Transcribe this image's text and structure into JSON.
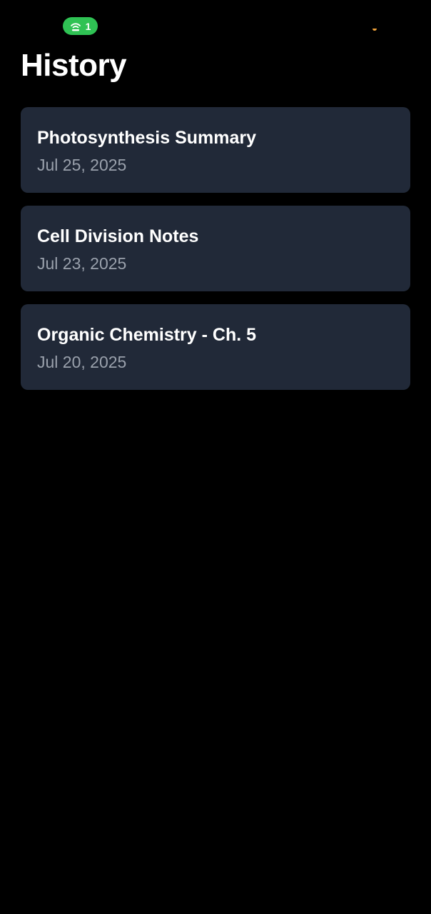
{
  "status_bar": {
    "hotspot_icon": "hotspot-icon",
    "hotspot_count": "1",
    "hotspot_color": "#2fc254",
    "privacy_indicator_color": "#f2a33a"
  },
  "page": {
    "title": "History"
  },
  "history": {
    "items": [
      {
        "title": "Photosynthesis Summary",
        "date": "Jul 25, 2025"
      },
      {
        "title": "Cell Division Notes",
        "date": "Jul 23, 2025"
      },
      {
        "title": "Organic Chemistry - Ch. 5",
        "date": "Jul 20, 2025"
      }
    ]
  },
  "colors": {
    "background": "#000000",
    "card_background": "#212938",
    "title_text": "#ffffff",
    "date_text": "#9aa1ac"
  }
}
